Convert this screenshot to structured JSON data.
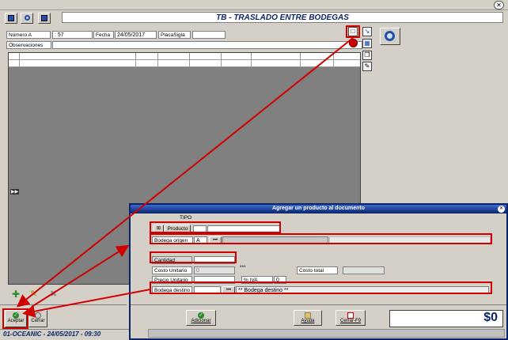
{
  "main": {
    "title": "TB - TRASLADO ENTRE BODEGAS",
    "header": {
      "numero_label": "Número A",
      "numero_value": ": 57",
      "fecha_label": "Fecha",
      "fecha_value": "24/05/2017",
      "placa_label": "PlacaSigla",
      "placa_value": "",
      "observaciones_label": "Observaciones",
      "observaciones_value": ""
    },
    "grid_marker": "▶▶",
    "buttons": {
      "aceptar": "Aceptar",
      "cerrar": "Cerrar"
    },
    "status_text": "01-OCEANIC - 24/05/2017 - 09:30"
  },
  "dialog": {
    "title": "Agregar un producto al documento",
    "tipo_label": "TIPO",
    "producto_label": "Producto",
    "producto_value": "",
    "bodega_origen_label": "Bodega origen",
    "bodega_origen_value": "A",
    "cantidad_label": "Cantidad",
    "cantidad_value": "",
    "costo_unitario_label": "Costo Unitario",
    "costo_unitario_value": "0",
    "costo_total_label": "Costo total",
    "costo_total_value": "",
    "dashes": "***",
    "precio_unitario_label": "Precio Unitario",
    "precio_unitario_value": "",
    "iva_label": "% IVA",
    "iva_value": "0",
    "bodega_destino_label": "Bodega destino",
    "bodega_destino_value": "",
    "bodega_destino_display": "** Bodega destino **",
    "buttons": {
      "adicionar": "Adicionar",
      "ayuda": "Ayuda",
      "cerrar_f9": "Cerrar-F9"
    },
    "total": "$0"
  },
  "colors": {
    "titlebar": "#0a246a",
    "grid": "#808080",
    "highlight": "#d00000"
  }
}
